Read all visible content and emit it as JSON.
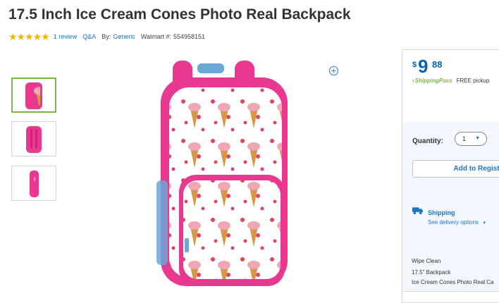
{
  "product": {
    "title": "17.5 Inch Ice Cream Cones Photo Real Backpack",
    "rating_stars": "★★★★★",
    "review_link": "1 review",
    "qa_link": "Q&A",
    "by_label": "By:",
    "brand": "Generic",
    "walmart_label": "Walmart #:",
    "walmart_number": "554958151",
    "rating": 5
  },
  "gallery": {
    "thumbnails": [
      {
        "view": "front",
        "selected": true
      },
      {
        "view": "back",
        "selected": false
      },
      {
        "view": "side",
        "selected": false
      }
    ],
    "zoom_icon": "zoom-plus-icon"
  },
  "buy_box": {
    "currency": "$",
    "price_whole": "9",
    "price_cents": "88",
    "shippingpass": "ShippingPass",
    "free_pickup": "FREE pickup",
    "quantity_label": "Quantity:",
    "quantity_value": "1",
    "add_to_registry": "Add to Registry",
    "shipping_title": "Shipping",
    "delivery_options": "See delivery options",
    "features": [
      "Wipe Clean",
      "17.5\" Backpack",
      "Ice Cream Cones Photo Real Ca"
    ]
  },
  "colors": {
    "accent_blue": "#1a75cf",
    "price_blue": "#0a63b3",
    "star": "#f4b400",
    "shippingpass_green": "#7ab648",
    "backpack_pink": "#e8388f"
  }
}
